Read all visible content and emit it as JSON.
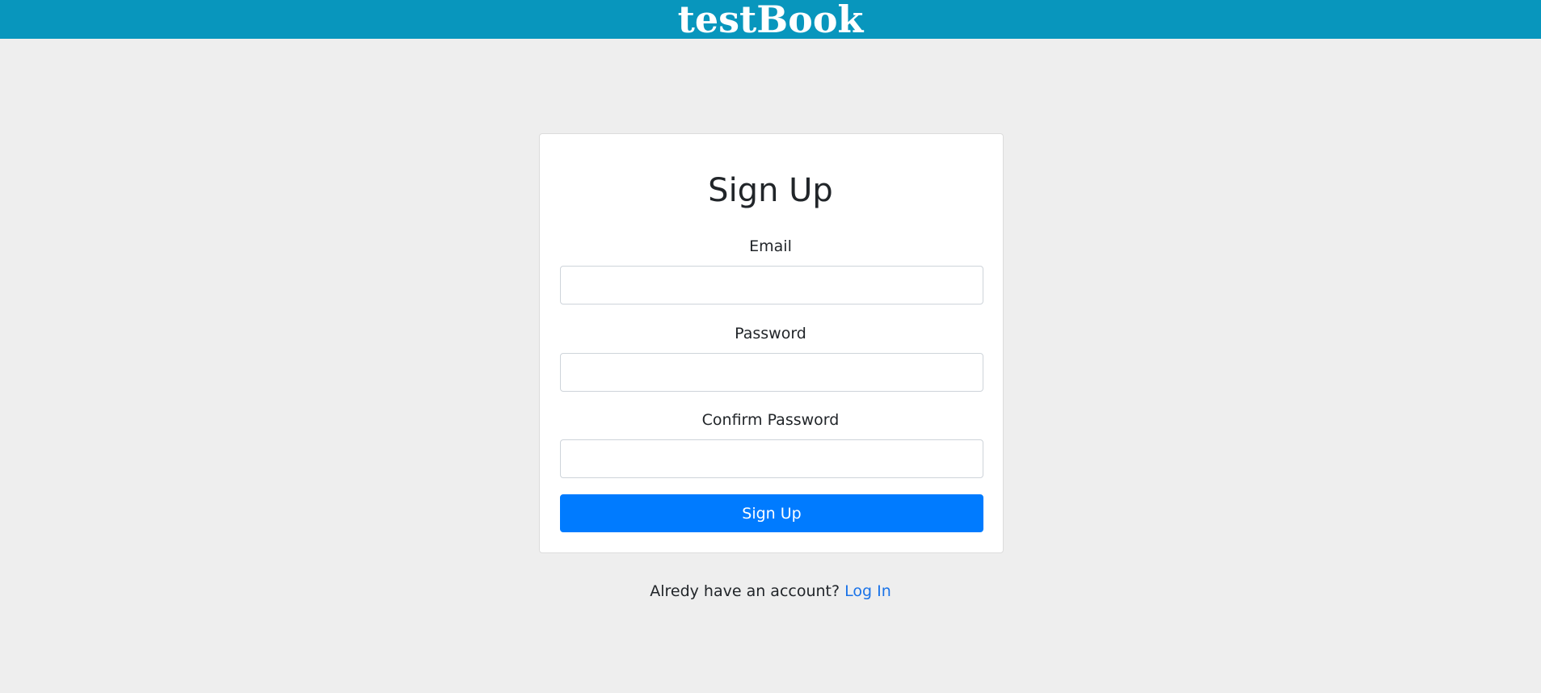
{
  "header": {
    "brand": "testBook",
    "bar_color": "#0896bd"
  },
  "form": {
    "title": "Sign Up",
    "fields": [
      {
        "label": "Email",
        "value": "",
        "placeholder": ""
      },
      {
        "label": "Password",
        "value": "",
        "placeholder": ""
      },
      {
        "label": "Confirm Password",
        "value": "",
        "placeholder": ""
      }
    ],
    "submit_label": "Sign Up",
    "submit_color": "#007bff"
  },
  "footer": {
    "prompt": "Alredy have an account?",
    "link_label": "Log In",
    "link_color": "#1a73e8"
  }
}
